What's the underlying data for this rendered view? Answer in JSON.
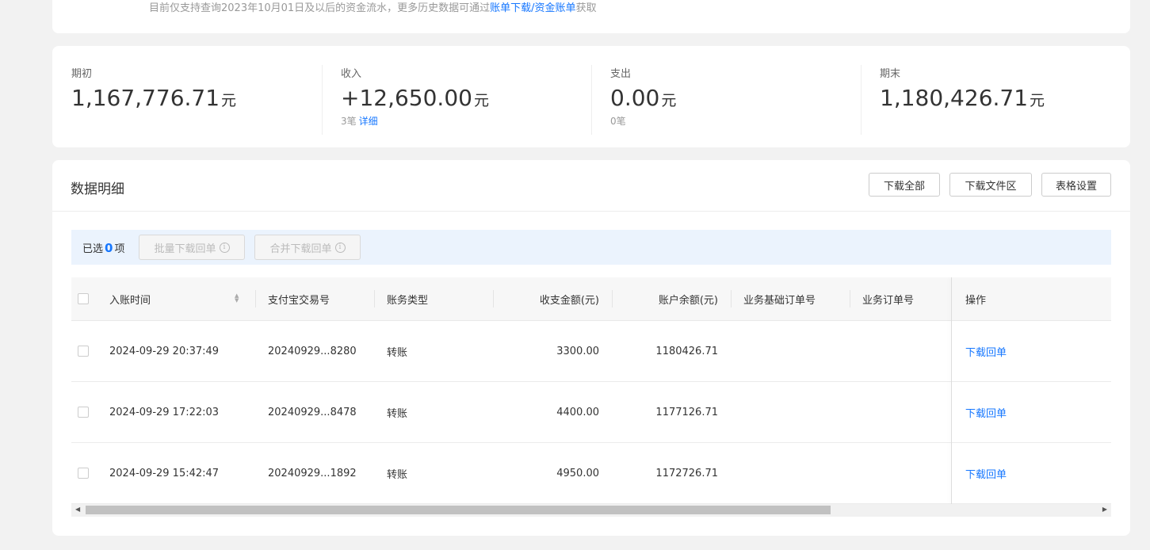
{
  "notice": {
    "prefix": "目前仅支持查询2023年10月01日及以后的资金流水，更多历史数据可通过",
    "link": "账单下载/资金账单",
    "suffix": "获取"
  },
  "summary": {
    "opening": {
      "label": "期初",
      "amount": "1,167,776.71",
      "unit": "元"
    },
    "income": {
      "label": "收入",
      "amount": "+12,650.00",
      "unit": "元",
      "count": "3笔",
      "detail_link": "详细"
    },
    "expense": {
      "label": "支出",
      "amount": "0.00",
      "unit": "元",
      "count": "0笔"
    },
    "closing": {
      "label": "期末",
      "amount": "1,180,426.71",
      "unit": "元"
    }
  },
  "detail": {
    "title": "数据明细",
    "buttons": {
      "download_all": "下载全部",
      "download_area": "下载文件区",
      "table_settings": "表格设置"
    },
    "selection": {
      "prefix": "已选",
      "count": "0",
      "suffix": "项",
      "batch_download": "批量下载回单",
      "merge_download": "合并下载回单"
    },
    "columns": [
      "入账时间",
      "支付宝交易号",
      "账务类型",
      "收支金额(元)",
      "账户余额(元)",
      "业务基础订单号",
      "业务订单号",
      "操作"
    ],
    "rows": [
      {
        "time": "2024-09-29 20:37:49",
        "trade_no": "20240929...8280",
        "type": "转账",
        "amount": "3300.00",
        "balance": "1180426.71",
        "action": "下载回单"
      },
      {
        "time": "2024-09-29 17:22:03",
        "trade_no": "20240929...8478",
        "type": "转账",
        "amount": "4400.00",
        "balance": "1177126.71",
        "action": "下载回单"
      },
      {
        "time": "2024-09-29 15:42:47",
        "trade_no": "20240929...1892",
        "type": "转账",
        "amount": "4950.00",
        "balance": "1172726.71",
        "action": "下载回单"
      }
    ]
  },
  "colors": {
    "link": "#1677ff",
    "selection_bar": "#ebf3fd",
    "page_bg": "#f2f2f2"
  }
}
